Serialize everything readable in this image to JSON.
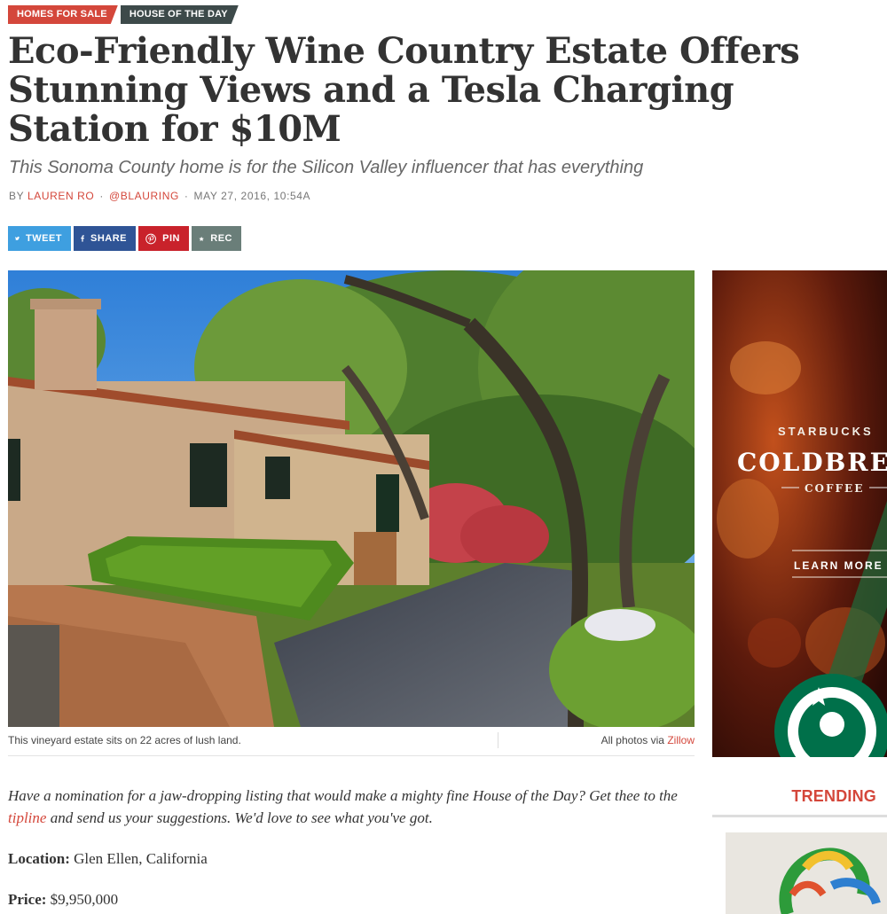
{
  "tags": [
    "HOMES FOR SALE",
    "HOUSE OF THE DAY"
  ],
  "headline": "Eco-Friendly Wine Country Estate Offers Stunning Views and a Tesla Charging Station for $10M",
  "subtitle": "This Sonoma County home is for the Silicon Valley influencer that has everything",
  "byline": {
    "prefix": "BY",
    "author": "LAUREN RO",
    "handle": "@BLAURING",
    "date": "MAY 27, 2016, 10:54A"
  },
  "share_buttons": {
    "tweet": "TWEET",
    "share": "SHARE",
    "pin": "PIN",
    "rec": "REC"
  },
  "hero": {
    "caption": "This vineyard estate sits on 22 acres of lush land.",
    "credit_prefix": "All photos via",
    "credit_link": "Zillow"
  },
  "intro": {
    "before_link": "Have a nomination for a jaw-dropping listing that would make a mighty fine House of the Day? Get thee to the",
    "link": "tipline",
    "after_link": "and send us your suggestions. We'd love to see what you've got."
  },
  "details": {
    "location_label": "Location:",
    "location_value": "Glen Ellen, California",
    "price_label": "Price:",
    "price_value": "$9,950,000"
  },
  "ad": {
    "brand": "STARBUCKS",
    "product": "COLDBRE",
    "product_sub": "COFFEE",
    "cta": "LEARN MORE"
  },
  "sidebar": {
    "trending": "TRENDING"
  },
  "colors": {
    "accent": "#d4473b",
    "tag_dark": "#3d4a4a",
    "twitter": "#3e9fe0",
    "facebook": "#2f5496",
    "pinterest": "#c9222b",
    "rec": "#6a7e79"
  },
  "icons": [
    "twitter-icon",
    "facebook-icon",
    "pinterest-icon",
    "star-icon"
  ]
}
